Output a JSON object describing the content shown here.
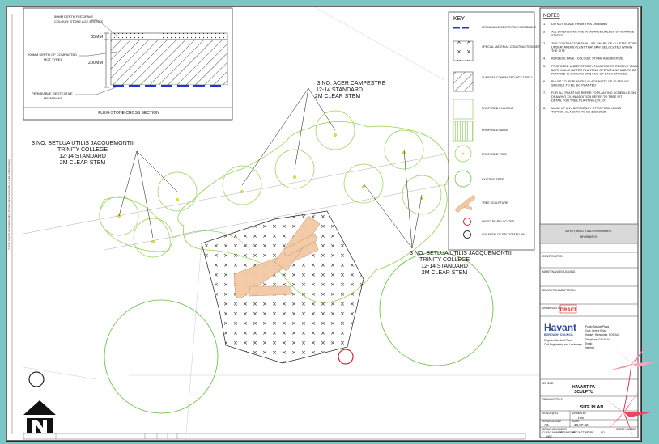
{
  "cross_section": {
    "title": "FLEXI-STONE CROSS SECTION",
    "top_label_1": "50MM DEPTH FLEXIPAVE",
    "top_label_2": "COLOUR: STONE AGE BRONZE",
    "left_label_1": "200MM DEPTH OF COMPACTED",
    "left_label_2": "MOT TYPE1",
    "dim_35": "35MM",
    "dim_200": "200MM",
    "bottom_label_1": "PERMEABLE GEOTEXTILE",
    "bottom_label_2": "MEMBRANE"
  },
  "annotations": {
    "acer_1": "3 NO. ACER CAMPESTRE",
    "acer_2": "12-14 STANDARD",
    "acer_3": "2M CLEAR STEM",
    "betula_a1": "3 NO. BETLUA UTILIS JACQUEMONTII",
    "betula_a2": "'TRINITY COLLEGE'",
    "betula_a3": "12-14 STANDARD",
    "betula_a4": "2M CLEAR STEM",
    "betula_b1": "3 NO. BETLUA UTILIS JACQUEMONTII",
    "betula_b2": "'TRINITY COLLEGE'",
    "betula_b3": "12-14 STANDARD",
    "betula_b4": "2M CLEAR STEM"
  },
  "key": {
    "title": "KEY",
    "items": [
      {
        "label": "PERMEABLE GEOTEXTILE MEMBRANE"
      },
      {
        "label": "SPECIAL MATERIAL CONSTRUCTION SEE NOTE 5"
      },
      {
        "label": "SUBBASE COMPACTED MOT TYPE 1"
      },
      {
        "label": "PROPOSED PLANTING"
      },
      {
        "label": "PROPOSED BULBS"
      },
      {
        "label": "PROPOSED TREE"
      },
      {
        "label": "EXISTING TREE"
      },
      {
        "label": "TREE SCULPTURE"
      },
      {
        "label": "BIN TO BE RELOCATED"
      },
      {
        "label": "LOCATION OF RELOCATED BIN"
      }
    ]
  },
  "notes": {
    "title": "NOTES",
    "items": [
      {
        "n": "1.",
        "t": "DO NOT SCALE FROM THIS DRAWING"
      },
      {
        "n": "2.",
        "t": "ALL DIMENSIONS ARE IN METRES UNLESS OTHERWISE STATED"
      },
      {
        "n": "3.",
        "t": "THE CONTRACTOR SHALL BE AWARE OF ALL STATUTORY UNDERTAKERS PLANT THAT MAY BE LOCATED WITHIN THE SITE"
      },
      {
        "n": "4.",
        "t": "KERLEDE PAVE - COLOUR: STONE AGE BRONZE."
      },
      {
        "n": "5.",
        "t": "PROPOSED UNDERSTOREY PLANTING TO RECEIVE 75MM BARK MULCH AFTER PLANTING OPERATIONS AND TO BE PLANTED IN GROUPS OF 5 FNG OF EACH SPECIES."
      },
      {
        "n": "6.",
        "t": "BULBS TO BE PLANTED IN A DENSITY OF 25 PER M2. SPECIES TO BE BIO PLANTED"
      },
      {
        "n": "7.",
        "t": "FOR ALL PLANTING REFER TO PLANTING SCHEDULE ON DRAWING XX. IN ADDITION REFER TO TREE PIT DETAIL FOR TREE PLANTING (XX.XX)"
      },
      {
        "n": "8.",
        "t": "MAKE UP ANY DEFICIENCY OF TOPSOIL USING TOPSOIL CLASS TO TO BS 3882:2015."
      }
    ]
  },
  "title_block": {
    "safety_1": "SAFETY, HEALTH AND ENVIRONMENT",
    "safety_2": "INFORMATION",
    "construction": "CONSTRUCTION",
    "maintenance": "MAINTENANCE/CLEANING",
    "demolition": "DEMOLITION/ADAPTATION",
    "drawing_status": "DRAWING STATUS",
    "status": "DRAFT",
    "brand": "Havant",
    "brand_sub": "BOROUGH COUNCIL",
    "regen_1": "Regeneration And Place",
    "regen_2": "Civil Engineering and Landscape",
    "addr_1": "Public Service Plaza",
    "addr_2": "Civic Centre Road",
    "addr_3": "Havant, Hampshire, PO9 2AX",
    "tel": "Telephone: 023 9244",
    "email": "Email:",
    "internet": "Internet",
    "scheme_label": "SCHEME",
    "scheme_1": "HAVANT PA",
    "scheme_2": "SCULPTU",
    "drawing_title_label": "DRAWING TITLE",
    "drawing_title": "SITE PLAN",
    "scale_label": "SCALE @ A1",
    "drawn_label": "DRAWN BY",
    "drawn": "HM",
    "original_label": "ORIGINAL SIZE",
    "size": "A3",
    "date_label": "DATE",
    "date": "18.07.22",
    "drawing_number_label": "DRAWING NUMBER",
    "client_label": "CLIENT NUMBER",
    "originator_label": "ORIGINATOR",
    "project_label": "PROJECT NO.",
    "type_label": "TYPE",
    "number_label": "NO.",
    "sheet_label": "SHEET NUMBER",
    "client": "HBC"
  }
}
